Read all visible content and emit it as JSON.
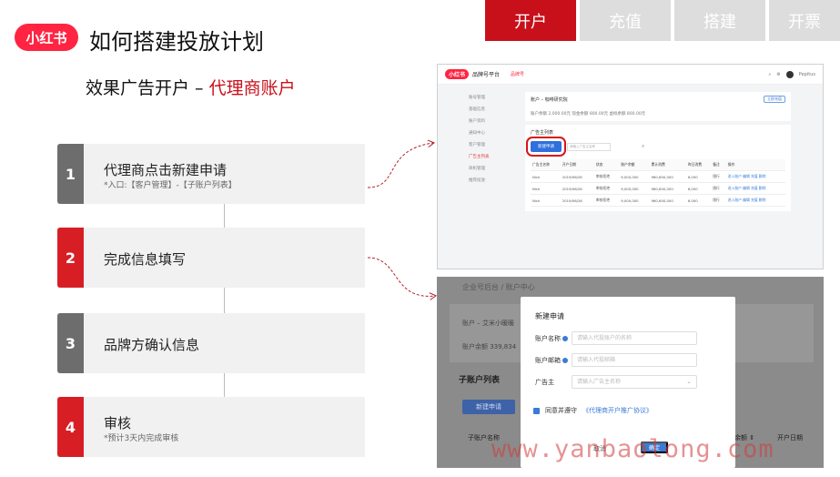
{
  "header": {
    "logo_text": "小红书",
    "title": "如何搭建投放计划",
    "tabs": [
      {
        "label": "开户",
        "active": true
      },
      {
        "label": "充值",
        "active": false
      },
      {
        "label": "搭建",
        "active": false
      },
      {
        "label": "开票",
        "active": false
      }
    ]
  },
  "subtitle": {
    "prefix": "效果广告开户 – ",
    "accent": "代理商账户"
  },
  "steps": [
    {
      "num": "1",
      "title": "代理商点击新建申请",
      "note": "*入口:【客户管理】-【子账户列表】",
      "color": "gray"
    },
    {
      "num": "2",
      "title": "完成信息填写",
      "note": "",
      "color": "red"
    },
    {
      "num": "3",
      "title": "品牌方确认信息",
      "note": "",
      "color": "gray"
    },
    {
      "num": "4",
      "title": "审核",
      "note": "*预计3天内完成审核",
      "color": "red"
    }
  ],
  "shot1": {
    "logo": "小红书",
    "brand": "品牌号平台",
    "crumb": "品牌号",
    "user": "Pepitus",
    "sidebar": [
      "账号管理",
      "基础信息",
      "账户资料",
      "通知中心",
      "客户管理",
      "广告主列表",
      "商机管理",
      "推荐投放"
    ],
    "sidebar_active": 5,
    "card1_title": "账户 – 咖啡研究院",
    "card1_meta": "账户余额 2,000.00元     现金余额 800.00元     虚拟余额 800.00元",
    "card1_button": "立即充值",
    "card2_title": "广告主列表",
    "new_button": "新建申请",
    "search_placeholder": "请输入广告主名称",
    "columns": [
      "广告主名称",
      "开户日期",
      "状态",
      "账户余额",
      "累计消费",
      "昨日消费",
      "备注",
      "操作"
    ],
    "rows": [
      [
        "Nick",
        "2019/06/26",
        "审核拒绝",
        "9,000,000",
        "960,600,000",
        "6,000",
        "限行",
        "进入账户  编辑  充值  删除"
      ],
      [
        "Nick",
        "2019/06/26",
        "审核拒绝",
        "9,000,000",
        "960,600,000",
        "6,000",
        "限行",
        "进入账户  编辑  充值  删除"
      ],
      [
        "Nick",
        "2019/06/26",
        "审核拒绝",
        "9,000,000",
        "960,600,000",
        "6,000",
        "限行",
        "进入账户  编辑  充值  删除"
      ]
    ]
  },
  "shot2": {
    "bg_breadcrumb": "企业号后台 / 账户中心",
    "bg_account": "账户 – 艾米小暖暖",
    "bg_balance": "账户余额 339,834",
    "bg_list_title": "子账户列表",
    "bg_new_button": "新建申请",
    "bg_col1": "子账户名称",
    "bg_col2": "户余额 ⇕",
    "bg_col3": "开户日期",
    "modal_title": "新建申请",
    "fields": [
      {
        "label": "账户名称",
        "placeholder": "请输入代投账户的名称",
        "info": true
      },
      {
        "label": "账户邮箱",
        "placeholder": "请输入代投邮箱",
        "info": true
      },
      {
        "label": "广告主",
        "placeholder": "请输入广告主名称",
        "info": false
      }
    ],
    "agree_text": "同意并遵守",
    "agree_link": "《代理商开户推广协议》",
    "cancel": "取消",
    "ok": "确定"
  },
  "watermark": "www.yanbaolong.com",
  "colors": {
    "accent": "#c8101b",
    "brand": "#ff2442",
    "link": "#3a7bd5"
  }
}
